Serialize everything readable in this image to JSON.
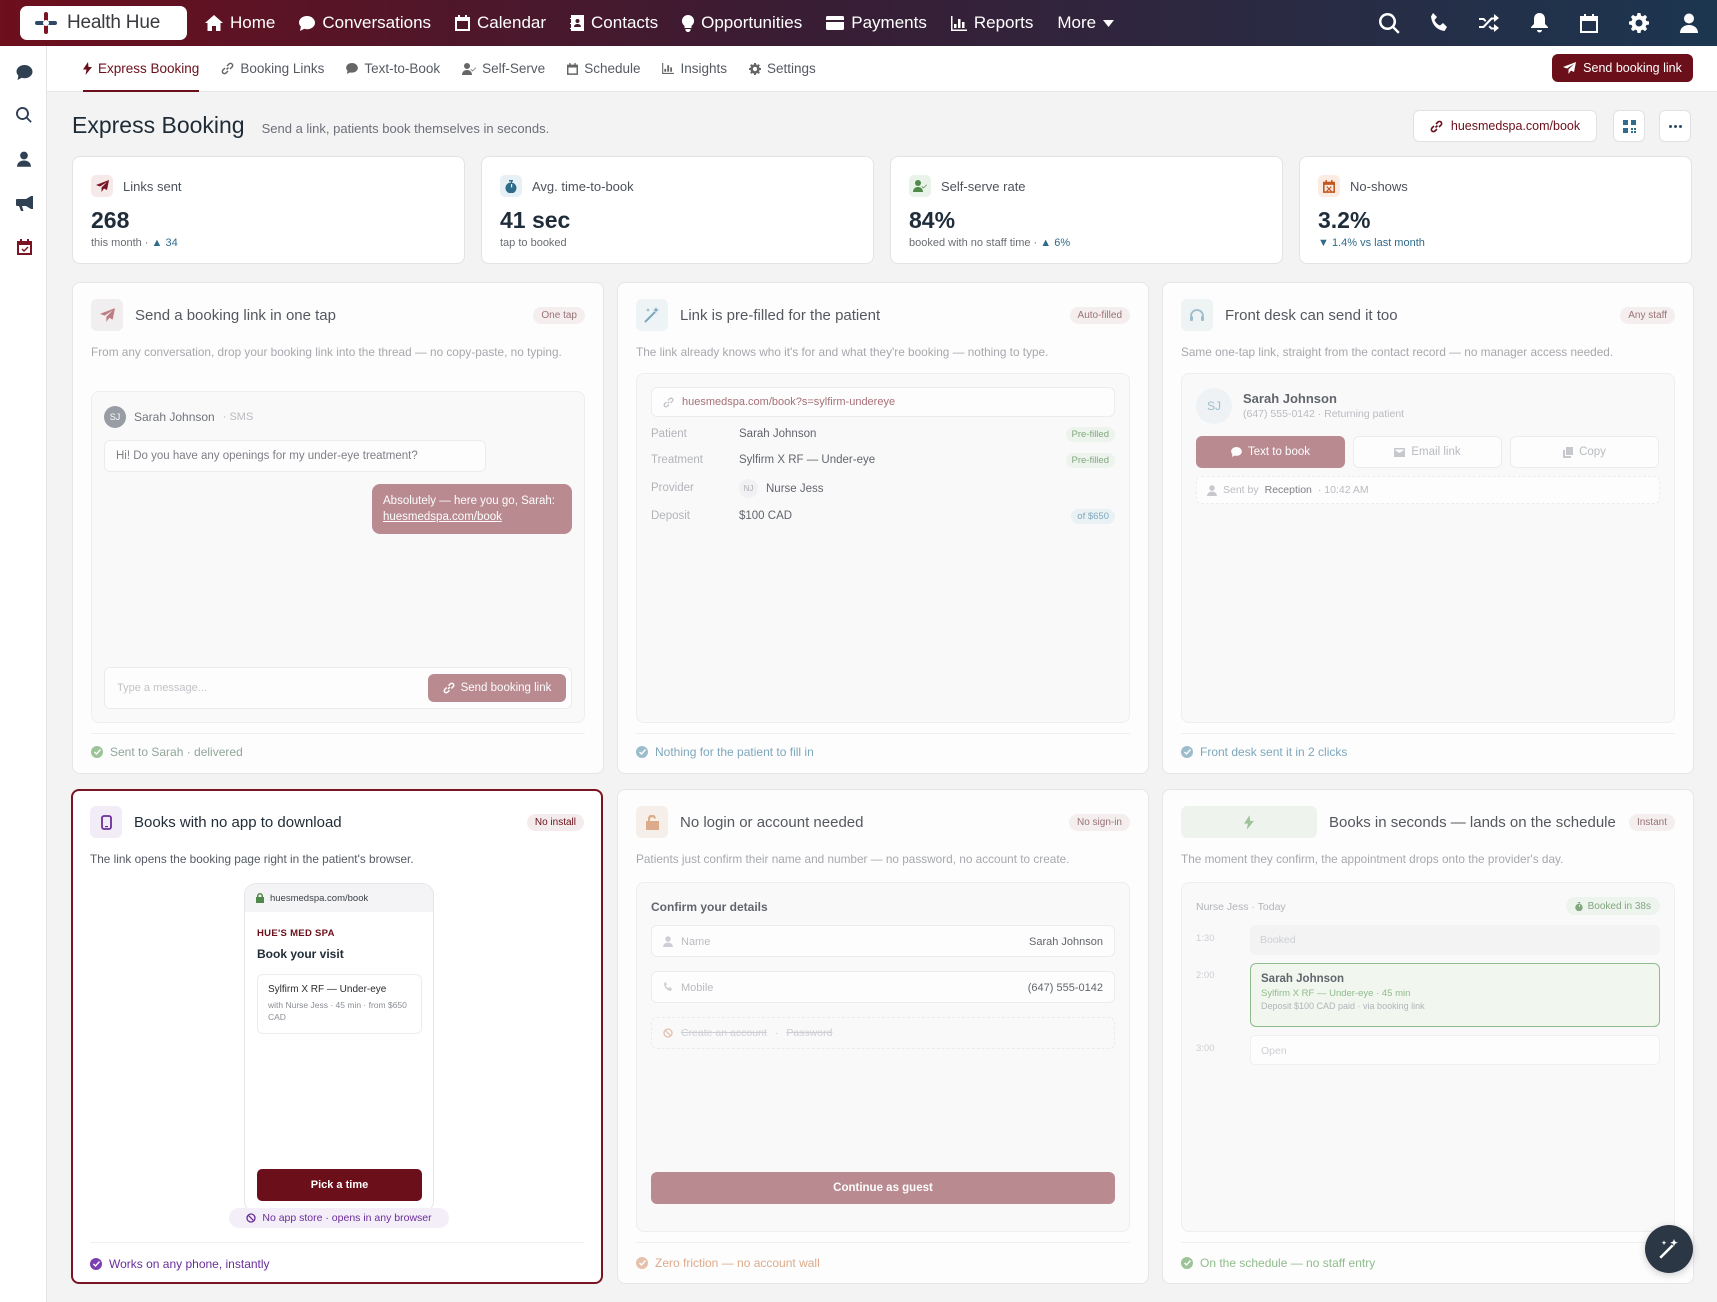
{
  "app": {
    "brand": "Health Hue"
  },
  "topnav": {
    "items": [
      {
        "label": "Home",
        "icon": "home-icon"
      },
      {
        "label": "Conversations",
        "icon": "chat-icon"
      },
      {
        "label": "Calendar",
        "icon": "calendar-icon"
      },
      {
        "label": "Contacts",
        "icon": "contacts-icon"
      },
      {
        "label": "Opportunities",
        "icon": "lightbulb-icon"
      },
      {
        "label": "Payments",
        "icon": "credit-card-icon"
      },
      {
        "label": "Reports",
        "icon": "bar-chart-icon"
      },
      {
        "label": "More",
        "icon": "caret-down-icon"
      }
    ],
    "right_icons": [
      "search-icon",
      "phone-icon",
      "shuffle-icon",
      "bell-icon",
      "calendar-icon",
      "gear-icon",
      "user-icon"
    ]
  },
  "rail": {
    "icons": [
      "chat-icon",
      "search-icon",
      "user-icon",
      "megaphone-icon",
      "calendar-check-icon"
    ]
  },
  "subnav": {
    "tabs": [
      {
        "label": "Express Booking",
        "icon": "bolt-icon",
        "active": true
      },
      {
        "label": "Booking Links",
        "icon": "link-icon"
      },
      {
        "label": "Text-to-Book",
        "icon": "chat-icon"
      },
      {
        "label": "Self-Serve",
        "icon": "user-check-icon"
      },
      {
        "label": "Schedule",
        "icon": "calendar-icon"
      },
      {
        "label": "Insights",
        "icon": "bar-chart-icon"
      },
      {
        "label": "Settings",
        "icon": "gear-icon"
      }
    ],
    "send_button": "Send booking link"
  },
  "header": {
    "title": "Express Booking",
    "subtitle": "Send a link, patients book themselves in seconds.",
    "url_button": "huesmedspa.com/book"
  },
  "stats": [
    {
      "label": "Links sent",
      "value": "268",
      "sub": "this month ·",
      "delta": "▲ 34",
      "icon": "send-icon",
      "color": "#7a1422"
    },
    {
      "label": "Avg. time-to-book",
      "value": "41 sec",
      "sub": "tap to booked",
      "delta": "",
      "icon": "stopwatch-icon",
      "color": "#2f6b8a"
    },
    {
      "label": "Self-serve rate",
      "value": "84%",
      "sub": "booked with no staff time ·",
      "delta": "▲ 6%",
      "icon": "user-check-icon",
      "color": "#4f8a4a"
    },
    {
      "label": "No-shows",
      "value": "3.2%",
      "sub": "",
      "delta": "▼ 1.4% vs last month",
      "icon": "calendar-x-icon",
      "color": "#c2571f"
    }
  ],
  "cards": {
    "one_tap": {
      "title": "Send a booking link in one tap",
      "pill": "One tap",
      "desc": "From any conversation, drop your booking link into the thread — no copy-paste, no typing.",
      "contact_initials": "SJ",
      "contact_name": "Sarah Johnson",
      "contact_channel": "· SMS",
      "msg_in": "Hi! Do you have any openings for my under-eye treatment?",
      "msg_out": "Absolutely — here you go, Sarah:",
      "msg_link": "huesmedspa.com/book",
      "input_placeholder": "Type a message...",
      "send_label": "Send booking link",
      "footer": "Sent to Sarah · delivered"
    },
    "prefilled": {
      "title": "Link is pre-filled for the patient",
      "pill": "Auto-filled",
      "desc": "The link already knows who it's for and what they're booking — nothing to type.",
      "url": "huesmedspa.com/book?s=sylfirm-undereye",
      "rows": [
        {
          "k": "Patient",
          "v": "Sarah Johnson",
          "tag": "Pre-filled"
        },
        {
          "k": "Treatment",
          "v": "Sylfirm X RF — Under-eye",
          "tag": "Pre-filled"
        },
        {
          "k": "Provider",
          "v": "Nurse Jess",
          "initials": "NJ",
          "tag": ""
        },
        {
          "k": "Deposit",
          "v": "$100 CAD",
          "tag": "of $650"
        }
      ],
      "footer": "Nothing for the patient to fill in"
    },
    "front_desk": {
      "title": "Front desk can send it too",
      "pill": "Any staff",
      "desc": "Same one-tap link, straight from the contact record — no manager access needed.",
      "initials": "SJ",
      "name": "Sarah Johnson",
      "meta": "(647) 555-0142 · Returning patient",
      "btn_text": "Text to book",
      "btn_email": "Email link",
      "btn_copy": "Copy",
      "sent_by_label": "Sent by",
      "sent_by": "Reception",
      "sent_time": "· 10:42 AM",
      "footer": "Front desk sent it in 2 clicks"
    },
    "no_app": {
      "title": "Books with no app to download",
      "pill": "No install",
      "desc": "The link opens the booking page right in the patient's browser.",
      "phone_url": "huesmedspa.com/book",
      "spa_name": "HUE'S MED SPA",
      "book_title": "Book your visit",
      "svc_name": "Sylfirm X RF — Under-eye",
      "svc_meta": "with Nurse Jess · 45 min · from $650 CAD",
      "cta": "Pick a time",
      "note": "No app store · opens in any browser",
      "footer": "Works on any phone, instantly"
    },
    "no_login": {
      "title": "No login or account needed",
      "pill": "No sign-in",
      "desc": "Patients just confirm their name and number — no password, no account to create.",
      "confirm_title": "Confirm your details",
      "name_label": "Name",
      "name_value": "Sarah Johnson",
      "mobile_label": "Mobile",
      "mobile_value": "(647) 555-0142",
      "create_account": "Create an account",
      "password": "Password",
      "continue": "Continue as guest",
      "footer": "Zero friction — no account wall"
    },
    "seconds": {
      "title": "Books in seconds — lands on the schedule",
      "pill": "Instant",
      "desc": "The moment they confirm, the appointment drops onto the provider's day.",
      "sched_head": "Nurse Jess · Today",
      "booked_badge": "Booked in 38s",
      "slots": [
        {
          "time": "1:30",
          "label": "Booked"
        },
        {
          "time": "2:00",
          "label": ""
        },
        {
          "time": "3:00",
          "label": "Open"
        }
      ],
      "appt_name": "Sarah Johnson",
      "appt_service": "Sylfirm X RF — Under-eye · 45 min",
      "appt_deposit": "Deposit $100 CAD paid · via booking link",
      "footer": "On the schedule — no staff entry"
    }
  }
}
